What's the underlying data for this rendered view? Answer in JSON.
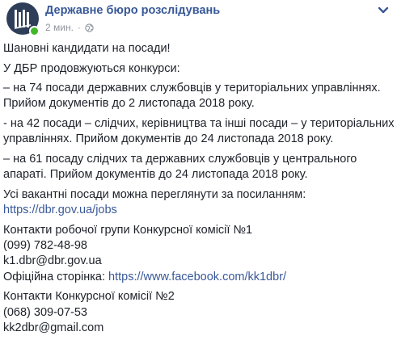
{
  "header": {
    "page_name": "Державне бюро розслідувань",
    "timestamp": "2 мин.",
    "separator": "·",
    "avatar_color": "#2e3e59",
    "link_color": "#385898",
    "online_color": "#42b72a",
    "icons": [
      "logo-icon",
      "globe-icon",
      "chevron-down-icon"
    ]
  },
  "post": {
    "greeting": "Шановні кандидати на посади!",
    "intro": "У ДБР продовжуються конкурси:",
    "item1": {
      "line1": "– на 74 посади державних службовців у територіальних управліннях.",
      "line2": "Прийом документів до 2 листопада 2018 року."
    },
    "item2": {
      "line1": "- на 42 посади – слідчих, керівництва та інші посади – у територіальних",
      "line2": "управліннях. Прийом документів до 24 листопада 2018 року."
    },
    "item3": {
      "line1": "– на 61 посаду слідчих та державних службовців у центрального",
      "line2": "апараті. Прийом документів до 24 листопада 2018 року."
    },
    "vacancies": {
      "text": "Усі вакантні посади можна переглянути за посиланням:",
      "link": "https://dbr.gov.ua/jobs"
    },
    "commission1": {
      "title": "Контакти робочої групи Конкурсної комісії №1",
      "phone": "(099) 782-48-98",
      "email": "k1.dbr@dbr.gov.ua",
      "page_label": "Офіційна сторінка: ",
      "page_link": "https://www.facebook.com/kk1dbr/"
    },
    "commission2": {
      "title": "Контакти Конкурсної комісії №2",
      "phone": "(068) 309-07-53",
      "email": "kk2dbr@gmail.com"
    }
  }
}
